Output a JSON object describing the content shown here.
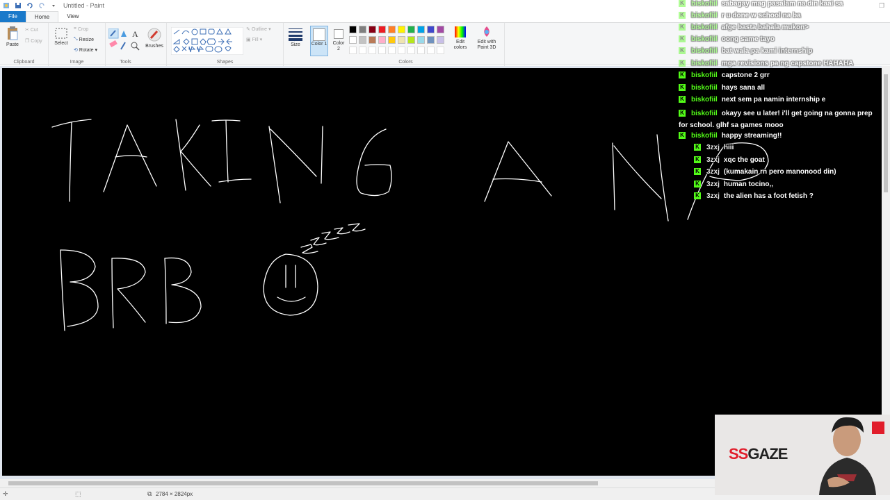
{
  "window": {
    "title": "Untitled - Paint"
  },
  "menu": {
    "tabs": [
      "File",
      "Home",
      "View"
    ]
  },
  "ribbon": {
    "clipboard": {
      "paste": "Paste",
      "cut": "Cut",
      "copy": "Copy",
      "label": "Clipboard"
    },
    "image": {
      "select": "Select",
      "crop": "Crop",
      "resize": "Resize",
      "rotate": "Rotate",
      "label": "Image"
    },
    "tools": {
      "label": "Tools",
      "brushes": "Brushes"
    },
    "shapes": {
      "outline": "Outline",
      "fill": "Fill",
      "label": "Shapes"
    },
    "size": {
      "label": "Size"
    },
    "colors": {
      "color1": "Color 1",
      "color2": "Color 2",
      "edit": "Edit colors",
      "paint3d": "Edit with Paint 3D",
      "label": "Colors",
      "palette_row1": [
        "#000000",
        "#7f7f7f",
        "#880015",
        "#ed1c24",
        "#ff7f27",
        "#fff200",
        "#22b14c",
        "#00a2e8",
        "#3f48cc",
        "#a349a4"
      ],
      "palette_row2": [
        "#ffffff",
        "#c3c3c3",
        "#b97a57",
        "#ffaec9",
        "#ffc90e",
        "#efe4b0",
        "#b5e61d",
        "#99d9ea",
        "#7092be",
        "#c8bfe7"
      ]
    }
  },
  "status": {
    "canvas_size": "2784 × 2824px"
  },
  "chat": {
    "messages": [
      {
        "user": "biskofiil",
        "text": "sabagay mag pasalam na din kaai sa",
        "faded": true
      },
      {
        "user": "biskofiil",
        "text": "r u done w school na ba",
        "faded": true
      },
      {
        "user": "biskofiil",
        "text": "afge basta bahala mukon>",
        "faded": true
      },
      {
        "user": "biskofiil",
        "text": "oong same tayo",
        "faded": true
      },
      {
        "user": "biskofiil",
        "text": "bat wala pa kami internship",
        "faded": true
      },
      {
        "user": "biskofiil",
        "text": "mga revisions pa ng capstone HAHAHA",
        "faded": true
      },
      {
        "user": "biskofiil",
        "text": "capstone 2 grr",
        "faded": false
      },
      {
        "user": "biskofiil",
        "text": "hays sana all",
        "faded": false
      },
      {
        "user": "biskofiil",
        "text": "next sem pa namin internship e",
        "faded": false
      },
      {
        "user": "biskofiil",
        "text": "okayy see u later! i'll get going na gonna prep for school. glhf sa games mooo",
        "faded": false
      },
      {
        "user": "biskofiil",
        "text": "happy streaming!!",
        "faded": false
      },
      {
        "user": "3zxj",
        "text": "hiii",
        "faded": false
      },
      {
        "user": "3zxj",
        "text": "xqc the goat",
        "faded": false
      },
      {
        "user": "3zxj",
        "text": "(kumakain rn pero manonood din)",
        "faded": false
      },
      {
        "user": "3zxj",
        "text": "human tocino,,",
        "faded": false
      },
      {
        "user": "3zxj",
        "text": "the alien has a foot fetish ?",
        "faded": false
      }
    ]
  },
  "webcam": {
    "logo_ss": "SS",
    "logo_gaze": "GAZE"
  },
  "colors": {
    "accent": "#1979ca",
    "chat_user": "#53fc18",
    "brand_red": "#e11d2b"
  }
}
